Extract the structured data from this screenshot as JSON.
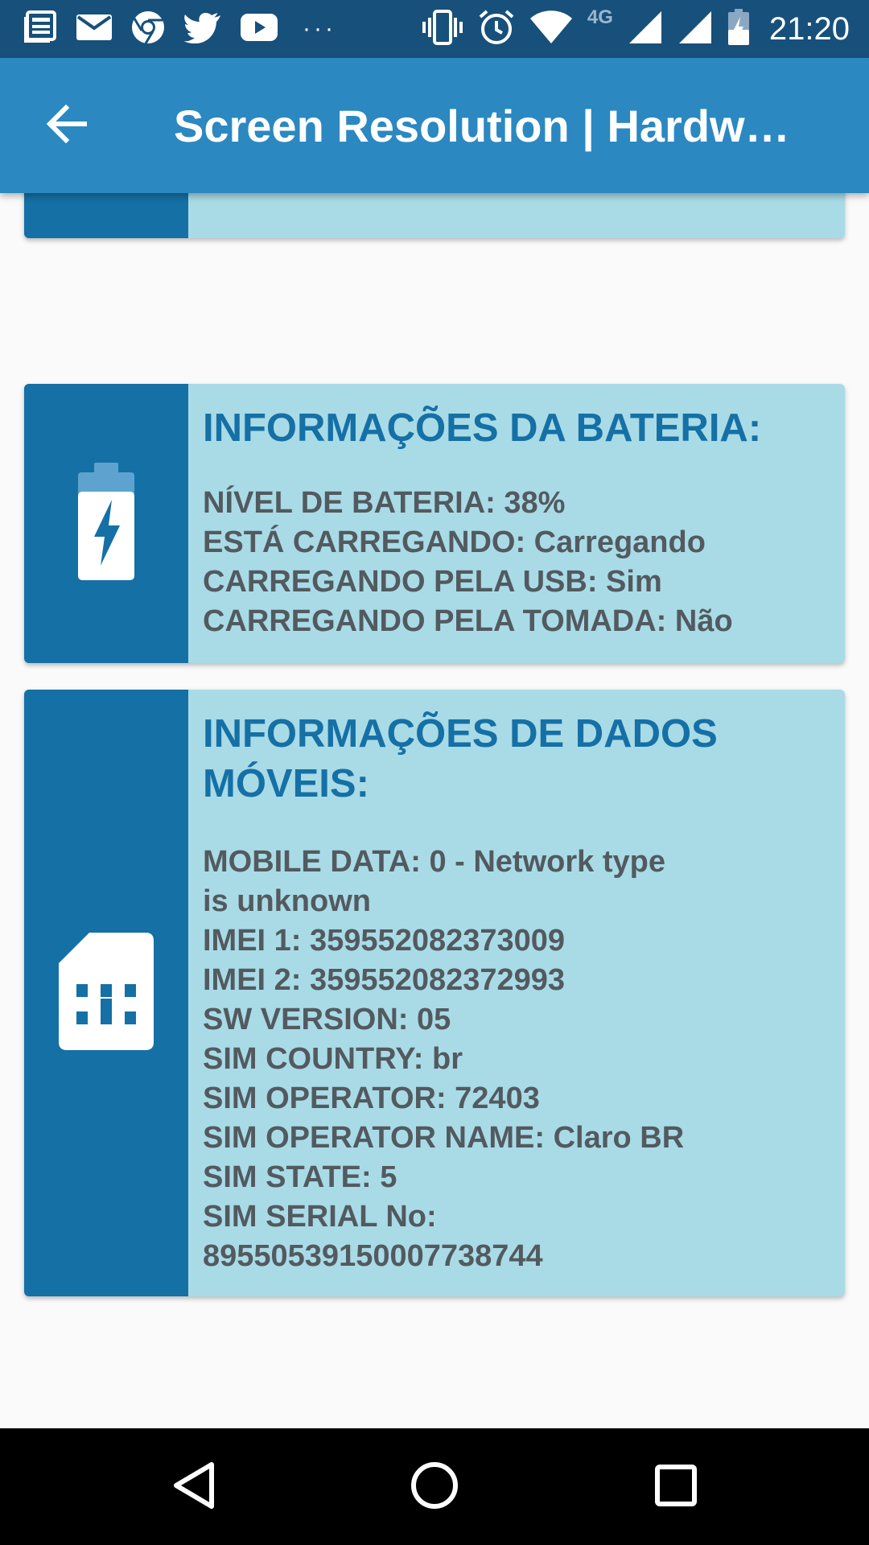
{
  "status_bar": {
    "network_label": "4G",
    "time": "21:20",
    "icons": [
      "news-icon",
      "email-icon",
      "chrome-icon",
      "twitter-icon",
      "youtube-icon",
      "more-notifications-icon",
      "vibrate-icon",
      "alarm-icon",
      "wifi-icon",
      "signal-icon",
      "signal-icon",
      "battery-charging-icon"
    ]
  },
  "app_bar": {
    "title": "Screen Resolution | Hardwa…",
    "back_icon": "arrow-back-icon"
  },
  "battery_card": {
    "icon": "battery-charging-icon",
    "title": "INFORMAÇÕES DA BATERIA:",
    "lines": [
      "NÍVEL DE BATERIA: 38%",
      "ESTÁ CARREGANDO: Carregando",
      "CARREGANDO PELA USB: Sim",
      "CARREGANDO PELA TOMADA: Não"
    ]
  },
  "mobile_card": {
    "icon": "sim-card-icon",
    "title_line1": "INFORMAÇÕES DE DADOS",
    "title_line2": "MÓVEIS:",
    "lines": [
      "MOBILE DATA: 0 - Network type",
      "is unknown",
      "IMEI 1: 359552082373009",
      "IMEI 2: 359552082372993",
      "SW VERSION: 05",
      "SIM COUNTRY: br",
      "SIM OPERATOR: 72403",
      "SIM OPERATOR NAME: Claro BR",
      "SIM STATE: 5",
      "SIM SERIAL No:",
      "8955053915000773874​4"
    ]
  },
  "nav_bar": {
    "icons": [
      "nav-back-icon",
      "nav-home-icon",
      "nav-recents-icon"
    ]
  },
  "colors": {
    "status_bar": "#17507b",
    "app_bar": "#2b88c1",
    "card_side": "#1570a6",
    "card_body": "#a9dbe6",
    "title_text": "#1570a6",
    "body_text": "#525a60"
  }
}
